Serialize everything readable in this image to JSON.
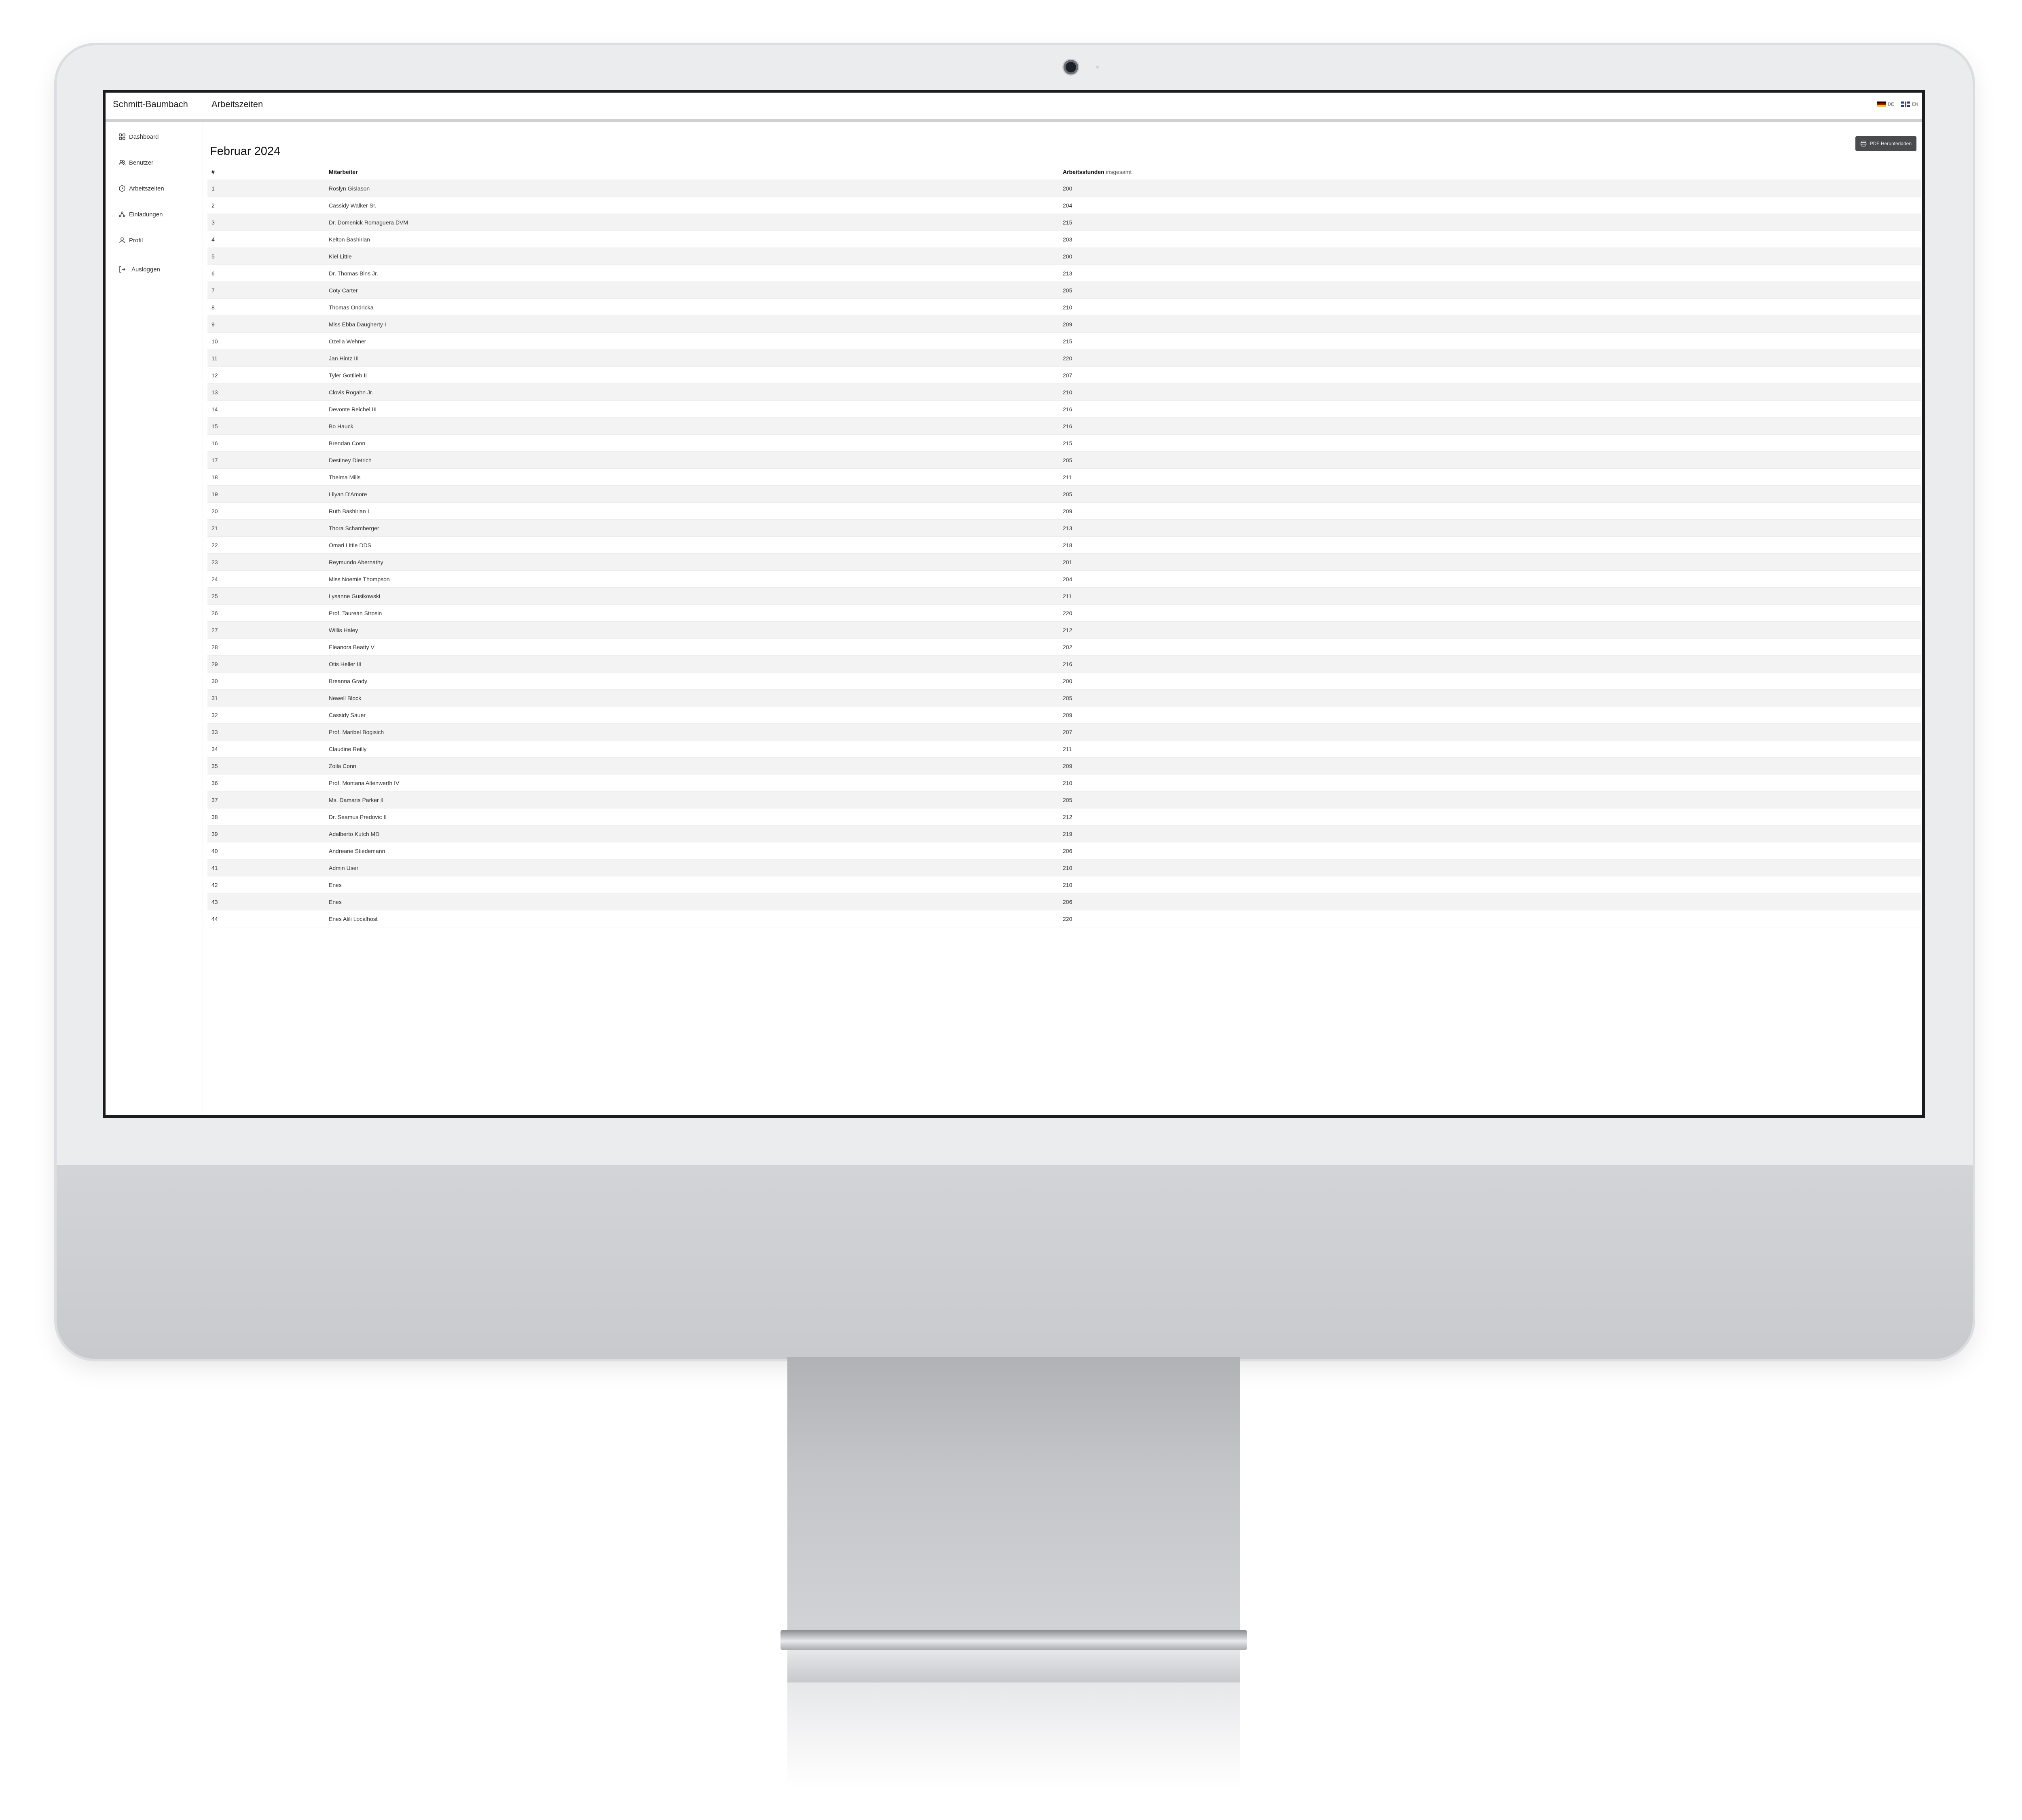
{
  "app": {
    "brand": "Schmitt-Baumbach",
    "breadcrumb": "Arbeitszeiten",
    "languages": [
      {
        "code": "DE",
        "flag": "flag-de-icon"
      },
      {
        "code": "EN",
        "flag": "flag-en-icon"
      }
    ]
  },
  "sidebar": {
    "items": [
      {
        "label": "Dashboard",
        "icon": "dashboard-grid-icon"
      },
      {
        "label": "Benutzer",
        "icon": "users-icon"
      },
      {
        "label": "Arbeitszeiten",
        "icon": "clock-icon"
      },
      {
        "label": "Einladungen",
        "icon": "invitations-icon"
      },
      {
        "label": "Profil",
        "icon": "user-icon"
      },
      {
        "label": "Ausloggen",
        "icon": "logout-icon"
      }
    ]
  },
  "main": {
    "title": "Februar 2024",
    "pdf_button": "PDF Herunterladen",
    "table": {
      "headers": {
        "num": "#",
        "name": "Mitarbeiter",
        "hours_bold": "Arbeitsstunden",
        "hours_light": "insgesamt"
      },
      "rows": [
        [
          "1",
          "Roslyn Gislason",
          "200"
        ],
        [
          "2",
          "Cassidy Walker Sr.",
          "204"
        ],
        [
          "3",
          "Dr. Domenick Romaguera DVM",
          "215"
        ],
        [
          "4",
          "Kelton Bashirian",
          "203"
        ],
        [
          "5",
          "Kiel Little",
          "200"
        ],
        [
          "6",
          "Dr. Thomas Bins Jr.",
          "213"
        ],
        [
          "7",
          "Coty Carter",
          "205"
        ],
        [
          "8",
          "Thomas Ondricka",
          "210"
        ],
        [
          "9",
          "Miss Ebba Daugherty I",
          "209"
        ],
        [
          "10",
          "Ozella Wehner",
          "215"
        ],
        [
          "11",
          "Jan Hintz III",
          "220"
        ],
        [
          "12",
          "Tyler Gottlieb II",
          "207"
        ],
        [
          "13",
          "Clovis Rogahn Jr.",
          "210"
        ],
        [
          "14",
          "Devonte Reichel III",
          "216"
        ],
        [
          "15",
          "Bo Hauck",
          "216"
        ],
        [
          "16",
          "Brendan Conn",
          "215"
        ],
        [
          "17",
          "Destiney Dietrich",
          "205"
        ],
        [
          "18",
          "Thelma Mills",
          "211"
        ],
        [
          "19",
          "Lilyan D'Amore",
          "205"
        ],
        [
          "20",
          "Ruth Bashirian I",
          "209"
        ],
        [
          "21",
          "Thora Schamberger",
          "213"
        ],
        [
          "22",
          "Omari Little DDS",
          "218"
        ],
        [
          "23",
          "Reymundo Abernathy",
          "201"
        ],
        [
          "24",
          "Miss Noemie Thompson",
          "204"
        ],
        [
          "25",
          "Lysanne Gusikowski",
          "211"
        ],
        [
          "26",
          "Prof. Taurean Strosin",
          "220"
        ],
        [
          "27",
          "Willis Haley",
          "212"
        ],
        [
          "28",
          "Eleanora Beatty V",
          "202"
        ],
        [
          "29",
          "Otis Heller III",
          "216"
        ],
        [
          "30",
          "Breanna Grady",
          "200"
        ],
        [
          "31",
          "Newell Block",
          "205"
        ],
        [
          "32",
          "Cassidy Sauer",
          "209"
        ],
        [
          "33",
          "Prof. Maribel Bogisich",
          "207"
        ],
        [
          "34",
          "Claudine Reilly",
          "211"
        ],
        [
          "35",
          "Zoila Conn",
          "209"
        ],
        [
          "36",
          "Prof. Montana Altenwerth IV",
          "210"
        ],
        [
          "37",
          "Ms. Damaris Parker II",
          "205"
        ],
        [
          "38",
          "Dr. Seamus Predovic II",
          "212"
        ],
        [
          "39",
          "Adalberto Kutch MD",
          "219"
        ],
        [
          "40",
          "Andreane Stiedemann",
          "206"
        ],
        [
          "41",
          "Admin User",
          "210"
        ],
        [
          "42",
          "Enes",
          "210"
        ],
        [
          "43",
          "Enes",
          "206"
        ],
        [
          "44",
          "Enes Alili Localhost",
          "220"
        ]
      ]
    }
  }
}
